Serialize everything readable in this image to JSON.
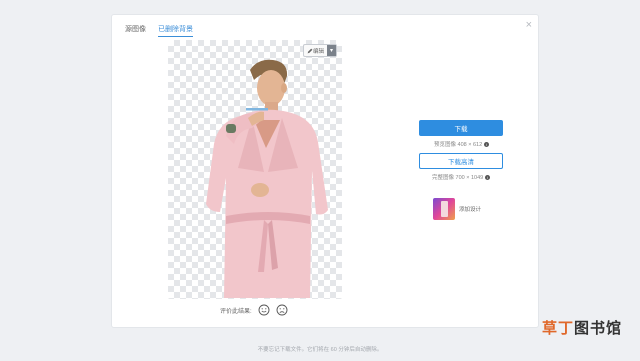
{
  "tabs": [
    {
      "label": "源图像",
      "active": false
    },
    {
      "label": "已删除背景",
      "active": true
    }
  ],
  "close_icon": "×",
  "editor": {
    "edit_label": "编辑",
    "edit_icon": "pencil-icon",
    "dropdown_icon": "▾"
  },
  "rating": {
    "label": "评价此结果:",
    "icons": [
      "smile-icon",
      "frown-icon"
    ]
  },
  "download": {
    "preview_button": "下载",
    "preview_label": "预览图像 408 × 612",
    "hd_button": "下载高清",
    "hd_label": "完整图像 700 × 1049",
    "info_icon": "i"
  },
  "design": {
    "label": "添加设计"
  },
  "footer": {
    "text": "不要忘记下载文件。它们将在 60 分钟后自动删除。"
  },
  "watermark": {
    "part_a": "草丁",
    "part_b": "图书馆"
  },
  "colors": {
    "accent": "#2e8de0",
    "robe": "#f2c6cb",
    "background": "#eef0f3"
  }
}
